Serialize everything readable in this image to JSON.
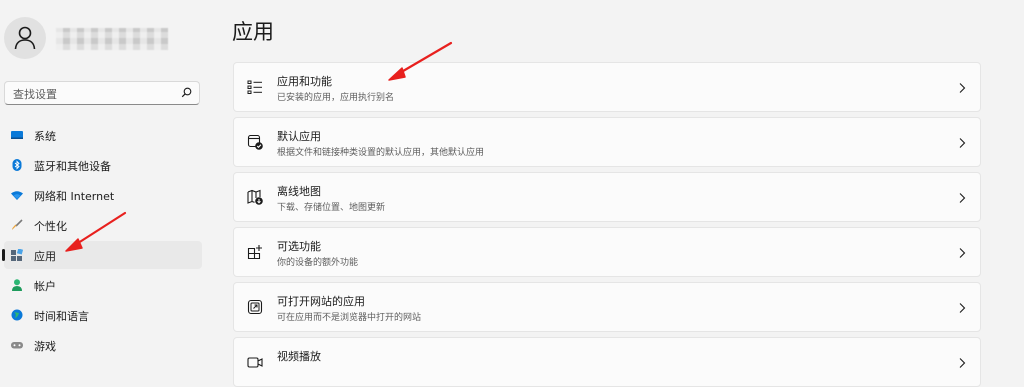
{
  "sidebar": {
    "search": {
      "placeholder": "查找设置",
      "value": ""
    },
    "items": [
      {
        "label": "系统",
        "icon": "monitor-icon"
      },
      {
        "label": "蓝牙和其他设备",
        "icon": "bluetooth-icon"
      },
      {
        "label": "网络和 Internet",
        "icon": "wifi-icon"
      },
      {
        "label": "个性化",
        "icon": "brush-icon"
      },
      {
        "label": "应用",
        "icon": "apps-icon",
        "selected": true
      },
      {
        "label": "帐户",
        "icon": "person-icon"
      },
      {
        "label": "时间和语言",
        "icon": "globe-clock-icon"
      },
      {
        "label": "游戏",
        "icon": "gamepad-icon"
      }
    ]
  },
  "main": {
    "title": "应用",
    "cards": [
      {
        "title": "应用和功能",
        "description": "已安装的应用，应用执行别名",
        "icon": "list-icon"
      },
      {
        "title": "默认应用",
        "description": "根据文件和链接种类设置的默认应用，其他默认应用",
        "icon": "default-app-icon"
      },
      {
        "title": "离线地图",
        "description": "下载、存储位置、地图更新",
        "icon": "map-download-icon"
      },
      {
        "title": "可选功能",
        "description": "你的设备的额外功能",
        "icon": "add-grid-icon"
      },
      {
        "title": "可打开网站的应用",
        "description": "可在应用而不是浏览器中打开的网站",
        "icon": "open-external-icon"
      },
      {
        "title": "视频播放",
        "description": "",
        "icon": "video-icon"
      }
    ]
  },
  "colors": {
    "accent": "#0067c0",
    "annotation_arrow": "#e8201e",
    "background": "#f3f3f3"
  }
}
